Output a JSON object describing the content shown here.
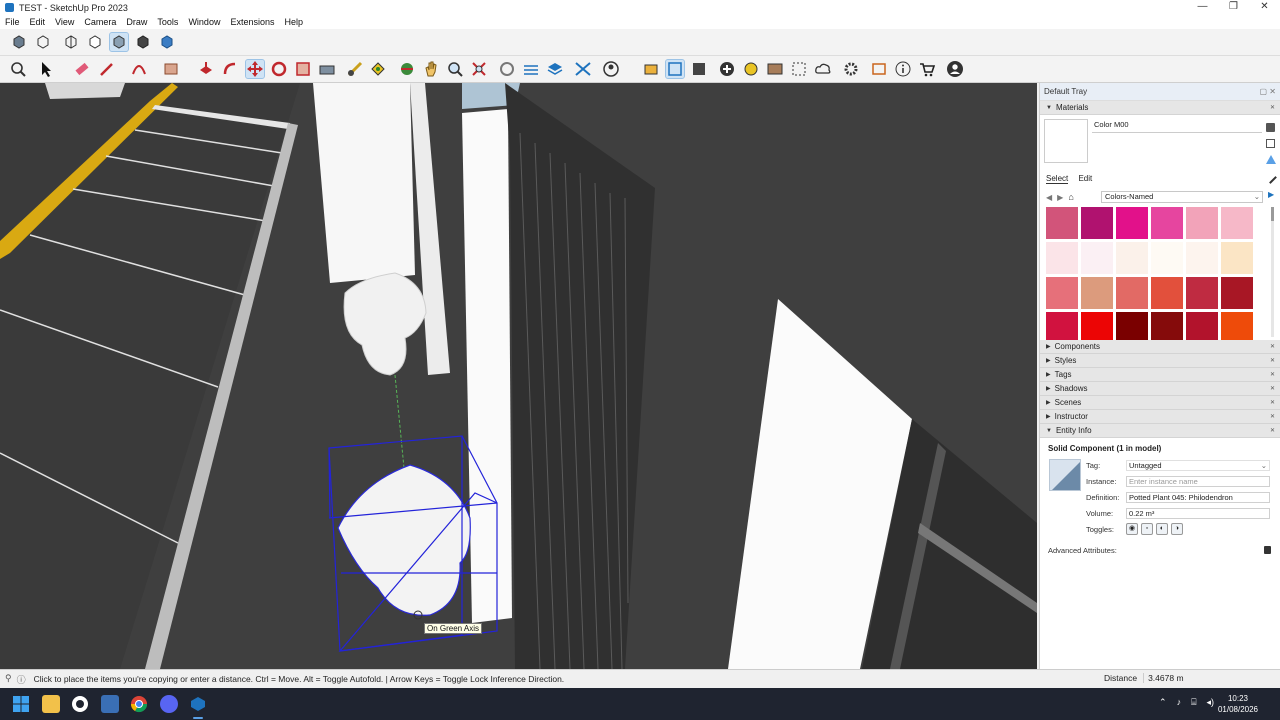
{
  "window": {
    "title": "TEST - SketchUp Pro 2023",
    "minimize": "—",
    "maximize": "❐",
    "close": "✕"
  },
  "menu": [
    "File",
    "Edit",
    "View",
    "Camera",
    "Draw",
    "Tools",
    "Window",
    "Extensions",
    "Help"
  ],
  "viewport": {
    "tooltip": "On Green Axis"
  },
  "tray": {
    "title": "Default Tray",
    "materials": {
      "header": "Materials",
      "name": "Color M00",
      "tab_select": "Select",
      "tab_edit": "Edit",
      "library": "Colors-Named",
      "swatches": [
        "#d2547a",
        "#b0126f",
        "#e2118a",
        "#e6459f",
        "#f2a3b9",
        "#f6b8c8",
        "#fbe4e8",
        "#fbf0f4",
        "#fbf1ea",
        "#fefaf4",
        "#fdf4ee",
        "#fbe5c5",
        "#e6707a",
        "#dc9b7d",
        "#e26a65",
        "#e2503c",
        "#bf2b41",
        "#a81725",
        "#d1123f",
        "#ec0505",
        "#7a0000",
        "#850b0b",
        "#b2132c",
        "#ee4b0a"
      ]
    },
    "panels": [
      "Components",
      "Styles",
      "Tags",
      "Shadows",
      "Scenes",
      "Instructor"
    ],
    "entity_info": {
      "header": "Entity Info",
      "title": "Solid Component (1 in model)",
      "tag_label": "Tag:",
      "tag_value": "Untagged",
      "instance_label": "Instance:",
      "instance_placeholder": "Enter instance name",
      "definition_label": "Definition:",
      "definition_value": "Potted Plant 045: Philodendron",
      "volume_label": "Volume:",
      "volume_value": "0.22 m³",
      "toggles_label": "Toggles:",
      "advanced": "Advanced Attributes:"
    }
  },
  "status": {
    "message": "Click to place the items you're copying or enter a distance. Ctrl = Move. Alt = Toggle Autofold. | Arrow Keys = Toggle Lock Inference Direction.",
    "distance_label": "Distance",
    "distance_value": "3.4678 m"
  },
  "clock": {
    "time": "10:23",
    "date": "01/08/2026"
  }
}
